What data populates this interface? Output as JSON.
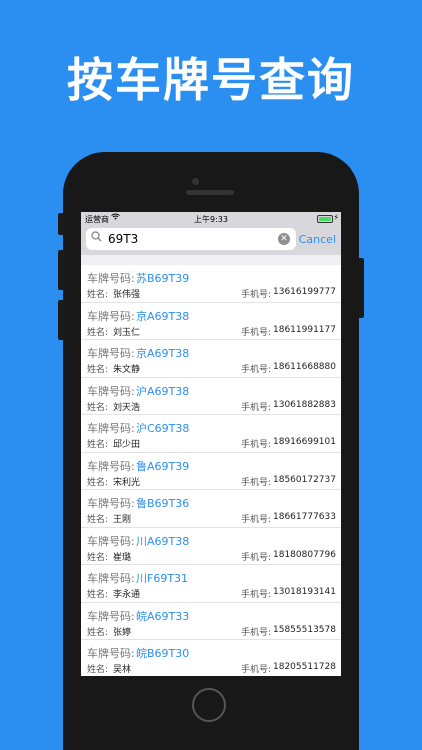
{
  "headline": "按车牌号查询",
  "status": {
    "carrier": "运营商",
    "wifi": "wifi-icon",
    "time": "上午9:33"
  },
  "search": {
    "value": "69T3",
    "cancel": "Cancel"
  },
  "labels": {
    "plate": "车牌号码:",
    "name": "姓名:",
    "phone": "手机号:"
  },
  "results": [
    {
      "plate": "苏B69T39",
      "name": "张伟强",
      "phone": "13616199777"
    },
    {
      "plate": "京A69T38",
      "name": "刘玉仁",
      "phone": "18611991177"
    },
    {
      "plate": "京A69T38",
      "name": "朱文静",
      "phone": "18611668880"
    },
    {
      "plate": "沪A69T38",
      "name": "刘天浩",
      "phone": "13061882883"
    },
    {
      "plate": "沪C69T38",
      "name": "邱少田",
      "phone": "18916699101"
    },
    {
      "plate": "鲁A69T39",
      "name": "宋利光",
      "phone": "18560172737"
    },
    {
      "plate": "鲁B69T36",
      "name": "王刚",
      "phone": "18661777633"
    },
    {
      "plate": "川A69T38",
      "name": "崔璐",
      "phone": "18180807796"
    },
    {
      "plate": "川F69T31",
      "name": "李永通",
      "phone": "13018193141"
    },
    {
      "plate": "皖A69T33",
      "name": "张婷",
      "phone": "15855513578"
    },
    {
      "plate": "皖B69T30",
      "name": "吴林",
      "phone": "18205511728"
    }
  ]
}
